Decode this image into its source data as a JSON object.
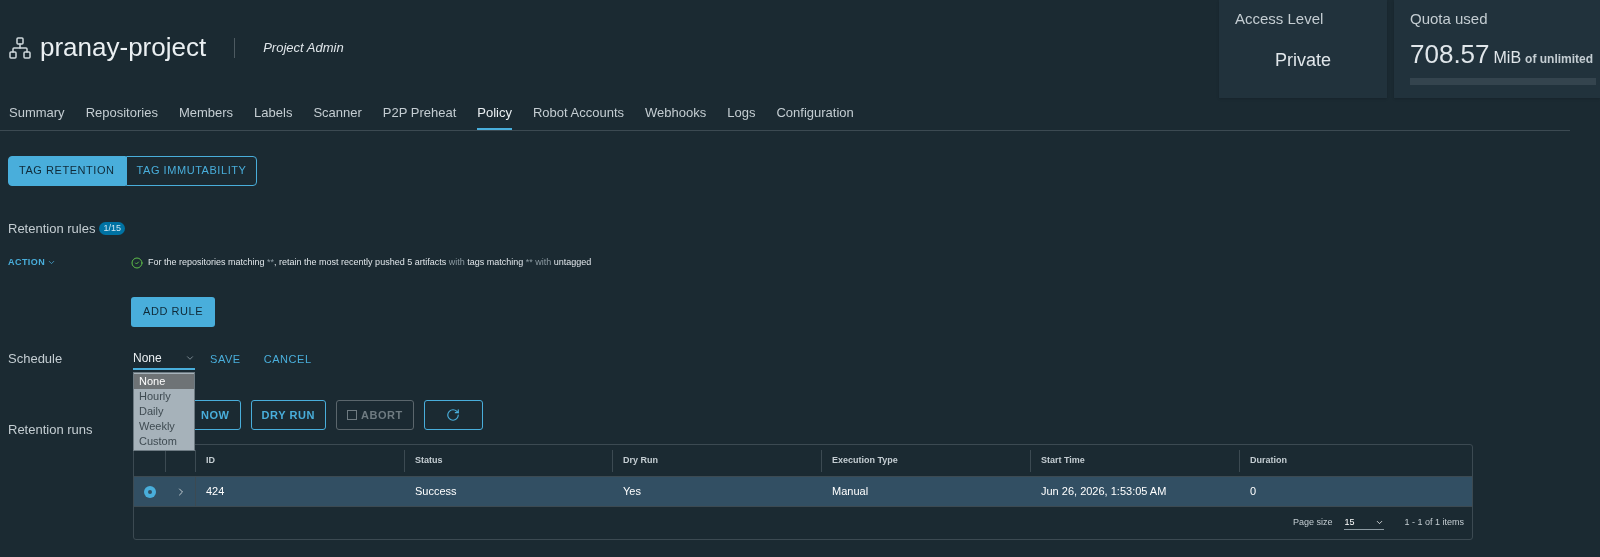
{
  "header": {
    "title": "pranay-project",
    "role": "Project Admin"
  },
  "cards": [
    {
      "label": "Access Level",
      "value": "Private"
    },
    {
      "label": "Quota used",
      "value": "708.57",
      "unit": "MiB",
      "suffix": "of unlimited"
    }
  ],
  "tabs": [
    {
      "label": "Summary",
      "selected": false
    },
    {
      "label": "Repositories",
      "selected": false
    },
    {
      "label": "Members",
      "selected": false
    },
    {
      "label": "Labels",
      "selected": false
    },
    {
      "label": "Scanner",
      "selected": false
    },
    {
      "label": "P2P Preheat",
      "selected": false
    },
    {
      "label": "Policy",
      "selected": true
    },
    {
      "label": "Robot Accounts",
      "selected": false
    },
    {
      "label": "Webhooks",
      "selected": false
    },
    {
      "label": "Logs",
      "selected": false
    },
    {
      "label": "Configuration",
      "selected": false
    }
  ],
  "subtabs": [
    {
      "label": "TAG RETENTION",
      "selected": true
    },
    {
      "label": "TAG IMMUTABILITY",
      "selected": false
    }
  ],
  "rules": {
    "title": "Retention rules",
    "count": "1/15",
    "action": "ACTION",
    "rule": [
      {
        "text": "For the repositories matching",
        "strong": true
      },
      {
        "text": " **",
        "strong": false
      },
      {
        "text": ", retain the most recently pushed 5 artifacts",
        "strong": true
      },
      {
        "text": " with ",
        "strong": false
      },
      {
        "text": "tags matching",
        "strong": true
      },
      {
        "text": " ** with ",
        "strong": false
      },
      {
        "text": "untagged",
        "strong": true
      }
    ],
    "add_button": "ADD RULE"
  },
  "schedule": {
    "label": "Schedule",
    "value": "None",
    "save": "SAVE",
    "cancel": "CANCEL",
    "options": [
      {
        "label": "None",
        "selected": true
      },
      {
        "label": "Hourly",
        "selected": false
      },
      {
        "label": "Daily",
        "selected": false
      },
      {
        "label": "Weekly",
        "selected": false
      },
      {
        "label": "Custom",
        "selected": false
      }
    ]
  },
  "runs": {
    "label": "Retention runs",
    "buttons": [
      {
        "label": "NOW",
        "disabled": false
      },
      {
        "label": "DRY RUN",
        "disabled": false
      },
      {
        "label": "ABORT",
        "disabled": true
      }
    ],
    "columns": [
      "ID",
      "Status",
      "Dry Run",
      "Execution Type",
      "Start Time",
      "Duration"
    ],
    "rows": [
      {
        "selected": true,
        "cells": [
          "424",
          "Success",
          "Yes",
          "Manual",
          "Jun 26, 2026, 1:53:05 AM",
          "0"
        ]
      }
    ],
    "page_size_label": "Page size",
    "page_size": "15",
    "range": "1 - 1 of 1 items"
  }
}
